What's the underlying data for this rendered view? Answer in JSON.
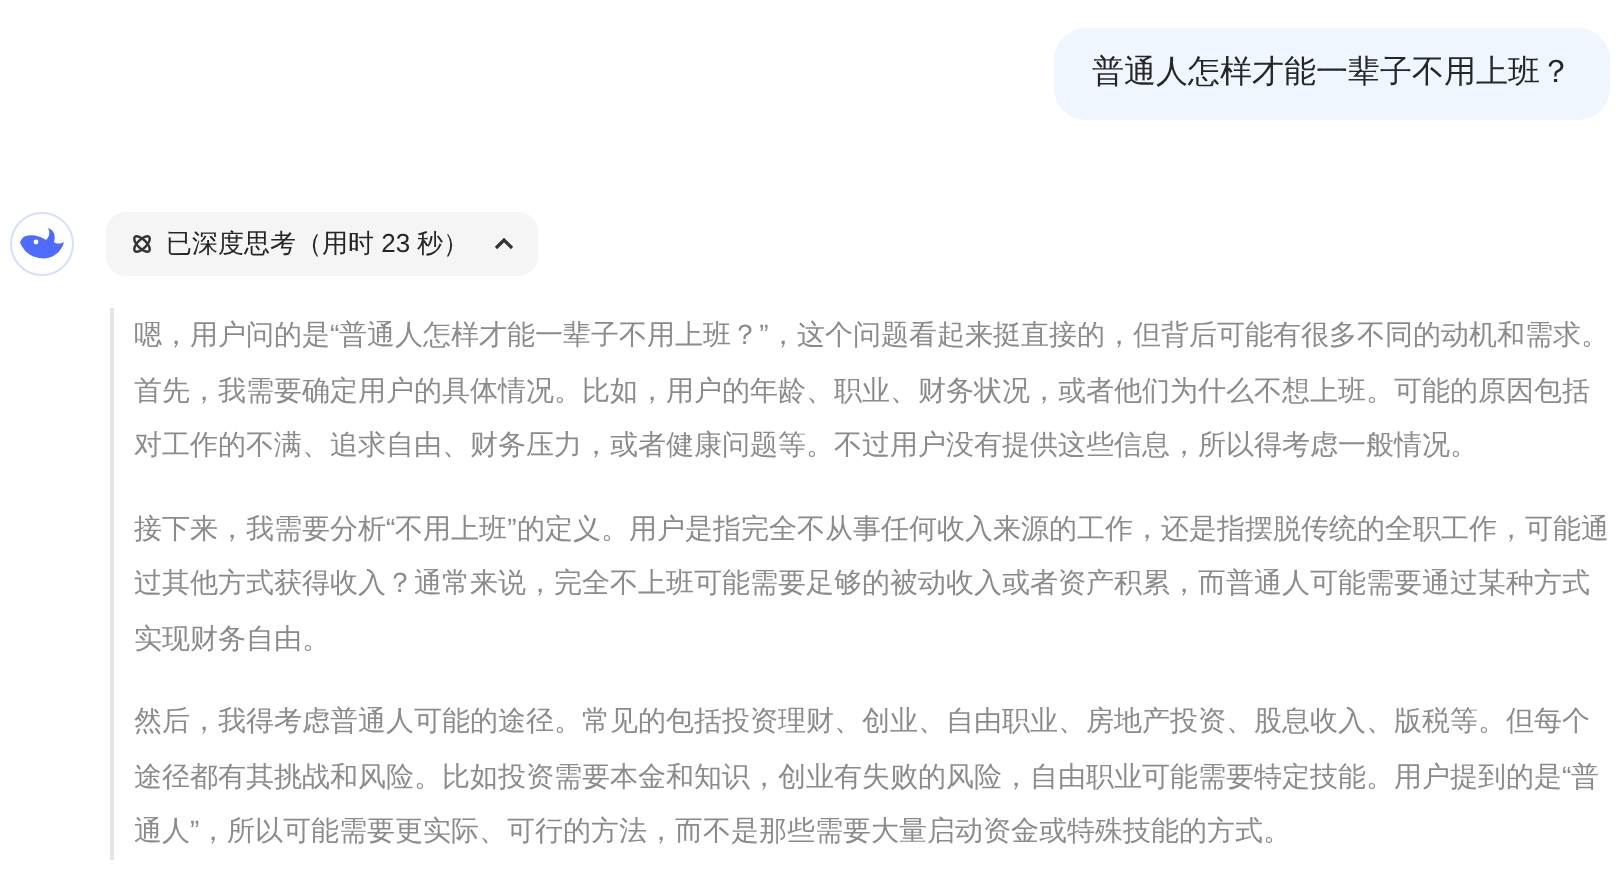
{
  "user_message": "普通人怎样才能一辈子不用上班？",
  "thinking": {
    "label": "已深度思考（用时 23 秒）",
    "expanded": true,
    "paragraphs": [
      "嗯，用户问的是“普通人怎样才能一辈子不用上班？”，这个问题看起来挺直接的，但背后可能有很多不同的动机和需求。首先，我需要确定用户的具体情况。比如，用户的年龄、职业、财务状况，或者他们为什么不想上班。可能的原因包括对工作的不满、追求自由、财务压力，或者健康问题等。不过用户没有提供这些信息，所以得考虑一般情况。",
      "接下来，我需要分析“不用上班”的定义。用户是指完全不从事任何收入来源的工作，还是指摆脱传统的全职工作，可能通过其他方式获得收入？通常来说，完全不上班可能需要足够的被动收入或者资产积累，而普通人可能需要通过某种方式实现财务自由。",
      "然后，我得考虑普通人可能的途径。常见的包括投资理财、创业、自由职业、房地产投资、股息收入、版税等。但每个途径都有其挑战和风险。比如投资需要本金和知识，创业有失败的风险，自由职业可能需要特定技能。用户提到的是“普通人”，所以可能需要更实际、可行的方法，而不是那些需要大量启动资金或特殊技能的方式。"
    ]
  }
}
